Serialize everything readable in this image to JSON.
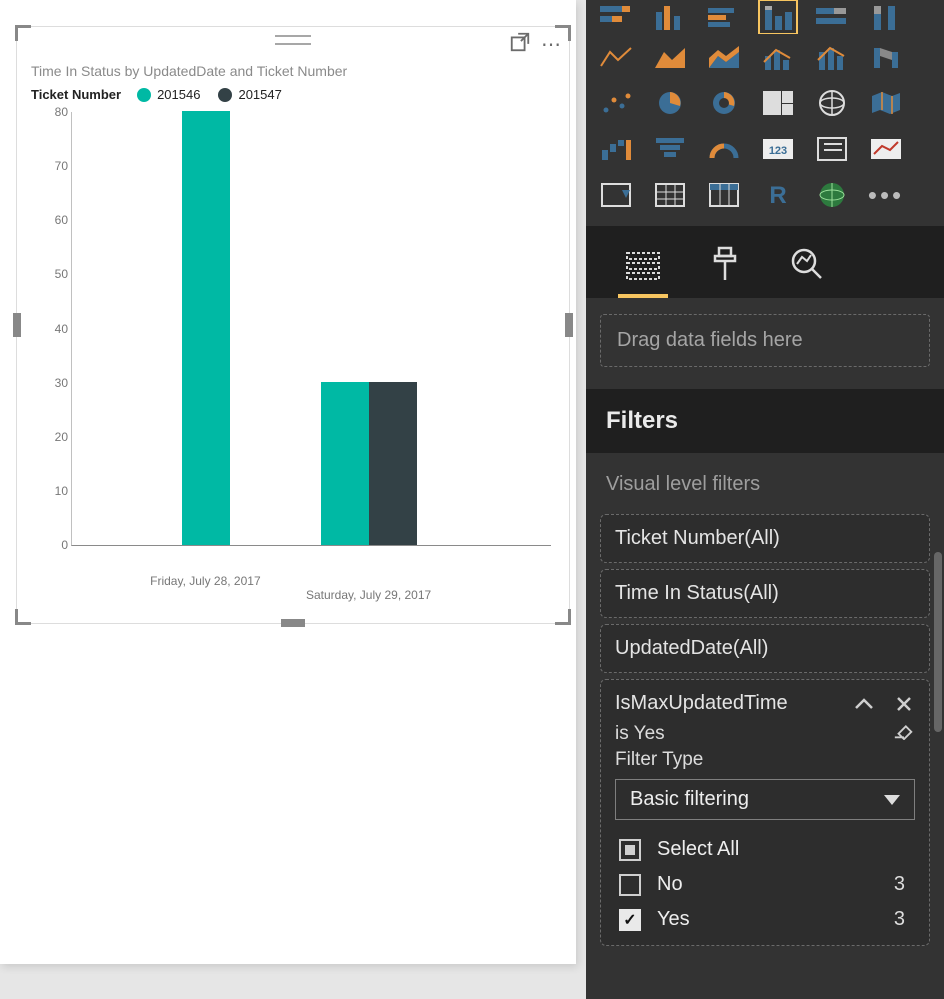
{
  "chart_data": {
    "type": "bar",
    "title": "Time In Status by UpdatedDate and Ticket Number",
    "legend_field": "Ticket Number",
    "categories": [
      "Friday, July 28, 2017",
      "Saturday, July 29, 2017"
    ],
    "series": [
      {
        "name": "201546",
        "color": "#00b9a4",
        "values": [
          80,
          30
        ]
      },
      {
        "name": "201547",
        "color": "#334146",
        "values": [
          null,
          30
        ]
      }
    ],
    "ylim": [
      0,
      80
    ],
    "yticks": [
      0,
      10,
      20,
      30,
      40,
      50,
      60,
      70,
      80
    ],
    "xlabel": "",
    "ylabel": ""
  },
  "pane": {
    "drop_fields": "Drag data fields here",
    "filters_header": "Filters",
    "visual_filters_header": "Visual level filters",
    "filter_cards": {
      "ticket": "Ticket Number(All)",
      "timeinstatus": "Time In Status(All)",
      "updateddate": "UpdatedDate(All)"
    },
    "expanded": {
      "name": "IsMaxUpdatedTime",
      "summary": "is Yes",
      "type_label": "Filter Type",
      "type_value": "Basic filtering",
      "options": {
        "select_all": "Select All",
        "no": {
          "label": "No",
          "count": "3"
        },
        "yes": {
          "label": "Yes",
          "count": "3"
        }
      }
    }
  }
}
